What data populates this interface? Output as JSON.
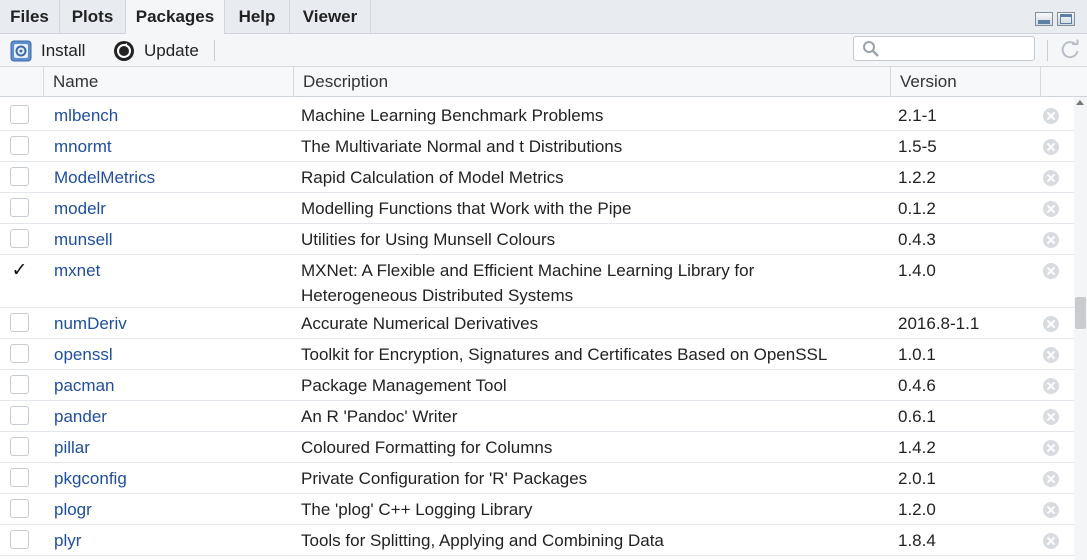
{
  "tabs": [
    {
      "label": "Files",
      "active": false
    },
    {
      "label": "Plots",
      "active": false
    },
    {
      "label": "Packages",
      "active": true
    },
    {
      "label": "Help",
      "active": false
    },
    {
      "label": "Viewer",
      "active": false
    }
  ],
  "toolbar": {
    "install_label": "Install",
    "update_label": "Update",
    "search_value": "",
    "install_icon": "install-icon",
    "update_icon": "update-icon",
    "refresh_icon": "refresh-icon",
    "search_icon": "search-icon"
  },
  "columns": {
    "name": "Name",
    "description": "Description",
    "version": "Version"
  },
  "packages": [
    {
      "name": "mlbench",
      "description": "Machine Learning Benchmark Problems",
      "version": "2.1-1",
      "loaded": false
    },
    {
      "name": "mnormt",
      "description": "The Multivariate Normal and t Distributions",
      "version": "1.5-5",
      "loaded": false
    },
    {
      "name": "ModelMetrics",
      "description": "Rapid Calculation of Model Metrics",
      "version": "1.2.2",
      "loaded": false
    },
    {
      "name": "modelr",
      "description": "Modelling Functions that Work with the Pipe",
      "version": "0.1.2",
      "loaded": false
    },
    {
      "name": "munsell",
      "description": "Utilities for Using Munsell Colours",
      "version": "0.4.3",
      "loaded": false
    },
    {
      "name": "mxnet",
      "description": "MXNet: A Flexible and Efficient Machine Learning Library for Heterogeneous Distributed Systems",
      "version": "1.4.0",
      "loaded": true
    },
    {
      "name": "numDeriv",
      "description": "Accurate Numerical Derivatives",
      "version": "2016.8-1.1",
      "loaded": false
    },
    {
      "name": "openssl",
      "description": "Toolkit for Encryption, Signatures and Certificates Based on OpenSSL",
      "version": "1.0.1",
      "loaded": false
    },
    {
      "name": "pacman",
      "description": "Package Management Tool",
      "version": "0.4.6",
      "loaded": false
    },
    {
      "name": "pander",
      "description": "An R 'Pandoc' Writer",
      "version": "0.6.1",
      "loaded": false
    },
    {
      "name": "pillar",
      "description": "Coloured Formatting for Columns",
      "version": "1.4.2",
      "loaded": false
    },
    {
      "name": "pkgconfig",
      "description": "Private Configuration for 'R' Packages",
      "version": "2.0.1",
      "loaded": false
    },
    {
      "name": "plogr",
      "description": "The 'plog' C++ Logging Library",
      "version": "1.2.0",
      "loaded": false
    },
    {
      "name": "plyr",
      "description": "Tools for Splitting, Applying and Combining Data",
      "version": "1.8.4",
      "loaded": false
    }
  ],
  "colors": {
    "link": "#1f4e9e",
    "tabbar": "#e8ebef",
    "toolbar": "#f4f6f8"
  }
}
